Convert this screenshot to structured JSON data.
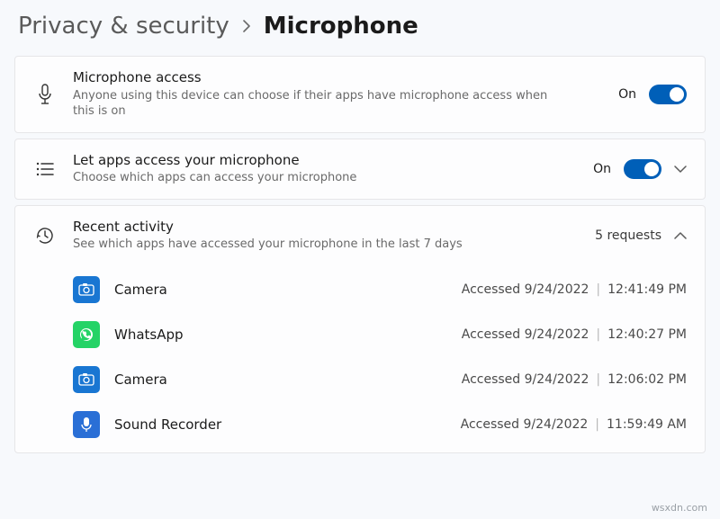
{
  "breadcrumb": {
    "parent": "Privacy & security",
    "current": "Microphone"
  },
  "settings": {
    "mic_access": {
      "title": "Microphone access",
      "sub": "Anyone using this device can choose if their apps have microphone access when this is on",
      "state": "On"
    },
    "let_apps": {
      "title": "Let apps access your microphone",
      "sub": "Choose which apps can access your microphone",
      "state": "On"
    }
  },
  "recent": {
    "title": "Recent activity",
    "sub": "See which apps have accessed your microphone in the last 7 days",
    "count_label": "5 requests",
    "items": [
      {
        "name": "Camera",
        "icon": "camera",
        "accessed": "Accessed 9/24/2022",
        "time": "12:41:49 PM"
      },
      {
        "name": "WhatsApp",
        "icon": "whatsapp",
        "accessed": "Accessed 9/24/2022",
        "time": "12:40:27 PM"
      },
      {
        "name": "Camera",
        "icon": "camera",
        "accessed": "Accessed 9/24/2022",
        "time": "12:06:02 PM"
      },
      {
        "name": "Sound Recorder",
        "icon": "recorder",
        "accessed": "Accessed 9/24/2022",
        "time": "11:59:49 AM"
      }
    ]
  },
  "watermark": "wsxdn.com"
}
